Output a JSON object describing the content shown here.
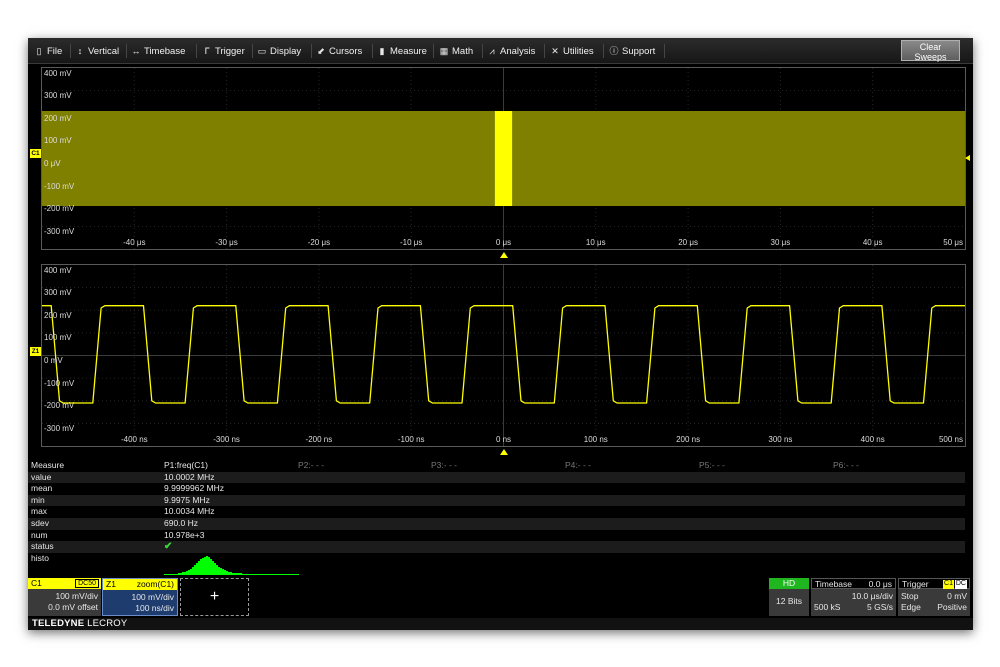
{
  "menu": {
    "file": "File",
    "vertical": "Vertical",
    "timebase": "Timebase",
    "trigger": "Trigger",
    "display": "Display",
    "cursors": "Cursors",
    "measure": "Measure",
    "math": "Math",
    "analysis": "Analysis",
    "utilities": "Utilities",
    "support": "Support",
    "clear_line1": "Clear",
    "clear_line2": "Sweeps"
  },
  "icons": {
    "file": "file-icon",
    "vertical": "vertical-arrows-icon",
    "timebase": "horizontal-arrows-icon",
    "trigger": "trigger-icon",
    "display": "display-icon",
    "cursors": "cursor-icon",
    "measure": "ruler-icon",
    "math": "calculator-icon",
    "analysis": "chart-icon",
    "utilities": "tools-icon",
    "support": "info-icon"
  },
  "colors": {
    "trace": "#ffff00",
    "envelope": "#808000",
    "histo": "#00ff00",
    "ok": "#38d838",
    "zoom_box": "#1e3c6e"
  },
  "grid1": {
    "trace_label": "C1",
    "y_labels": [
      "400 mV",
      "300 mV",
      "200 mV",
      "100 mV",
      "0 μV",
      "-100 mV",
      "-200 mV",
      "-300 mV"
    ],
    "x_labels": [
      "-40 μs",
      "-30 μs",
      "-20 μs",
      "-10 μs",
      "0 μs",
      "10 μs",
      "20 μs",
      "30 μs",
      "40 μs",
      "50 μs"
    ],
    "envelope_mV": [
      -210,
      210
    ],
    "zoom_window_us": [
      -0.5,
      0.5
    ]
  },
  "grid2": {
    "trace_label": "Z1",
    "y_labels": [
      "400 mV",
      "300 mV",
      "200 mV",
      "100 mV",
      "0 mV",
      "-100 mV",
      "-200 mV",
      "-300 mV"
    ],
    "x_labels": [
      "-400 ns",
      "-300 ns",
      "-200 ns",
      "-100 ns",
      "0 ns",
      "100 ns",
      "200 ns",
      "300 ns",
      "400 ns",
      "500 ns"
    ],
    "x_range_ns": [
      -500,
      500
    ],
    "y_range_mV": [
      -400,
      400
    ],
    "wave": {
      "period_ns": 100,
      "high_mV": 220,
      "low_mV": -210,
      "rise_ns": 9,
      "first_rising_edge_ns": -490
    }
  },
  "measure": {
    "title": "Measure",
    "params": [
      "P1:freq(C1)",
      "P2:- - -",
      "P3:- - -",
      "P4:- - -",
      "P5:- - -",
      "P6:- - -"
    ],
    "rows": [
      {
        "label": "value",
        "value": "10.0002 MHz"
      },
      {
        "label": "mean",
        "value": "9.9999962 MHz"
      },
      {
        "label": "min",
        "value": "9.9975 MHz"
      },
      {
        "label": "max",
        "value": "10.0034 MHz"
      },
      {
        "label": "sdev",
        "value": "690.0 Hz"
      },
      {
        "label": "num",
        "value": "10.978e+3"
      },
      {
        "label": "status",
        "value": "✔"
      },
      {
        "label": "histo",
        "value": ""
      }
    ]
  },
  "c1": {
    "name": "C1",
    "coupling": "DC50",
    "vdiv": "100 mV/div",
    "offset": "0.0 mV offset"
  },
  "z1": {
    "name": "Z1",
    "source": "zoom(C1)",
    "vdiv": "100 mV/div",
    "tdiv": "100 ns/div"
  },
  "add_symbol": "+",
  "hd": {
    "label": "HD",
    "bits": "12 Bits"
  },
  "timebase": {
    "title": "Timebase",
    "delay": "0.0 μs",
    "tdiv": "10.0 μs/div",
    "samples": "500 kS",
    "rate": "5 GS/s"
  },
  "trigger": {
    "title": "Trigger",
    "source": "C1",
    "coupling": "DC",
    "mode": "Stop",
    "level": "0 mV",
    "type": "Edge",
    "slope": "Positive"
  },
  "brand": {
    "name": "TELEDYNE",
    "sub": "LECROY"
  }
}
